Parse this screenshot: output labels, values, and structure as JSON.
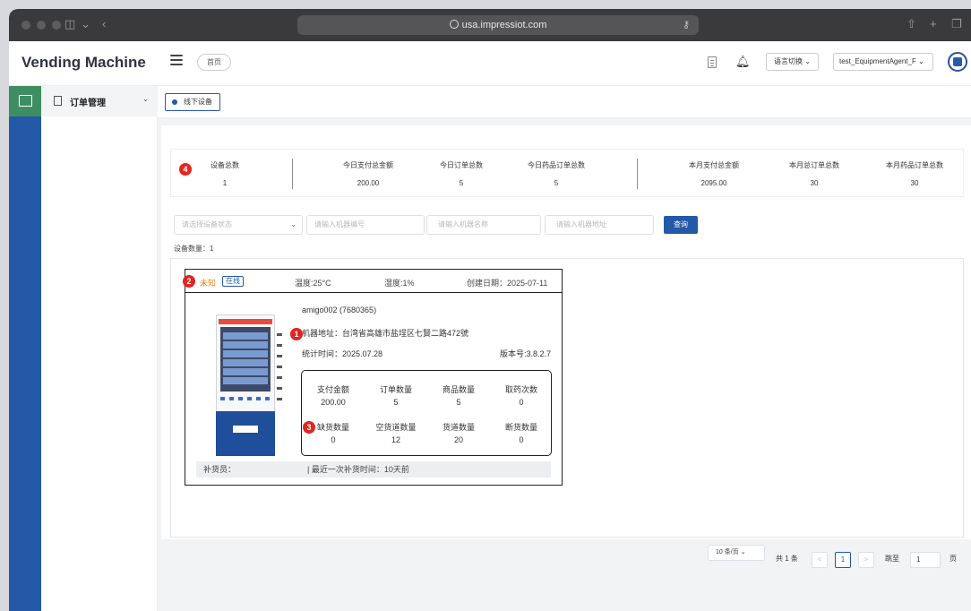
{
  "browser": {
    "url": "usa.impressiot.com"
  },
  "header": {
    "brand": "Vending Machine",
    "home_tab": "首页",
    "lang_label": "语言切换 ⌄",
    "agent_label": "test_EquipmentAgent_F ⌄"
  },
  "sidebar": {
    "menu_label": "订单管理",
    "chevron": "⌄"
  },
  "tagbar": {
    "active_tag": "线下设备"
  },
  "stats": [
    {
      "title": "设备总数",
      "value": "1"
    },
    {
      "title": "今日支付总金额",
      "value": "200.00"
    },
    {
      "title": "今日订单总数",
      "value": "5"
    },
    {
      "title": "今日药品订单总数",
      "value": "5"
    },
    {
      "title": "本月支付总金额",
      "value": "2095.00"
    },
    {
      "title": "本月总订单总数",
      "value": "30"
    },
    {
      "title": "本月药品订单总数",
      "value": "30"
    }
  ],
  "filters": {
    "status_placeholder": "请选择设备状态",
    "number_placeholder": "请输入机器编号",
    "name_placeholder": "请输入机器名称",
    "address_placeholder": "请输入机器地址",
    "query_label": "查询"
  },
  "device_count_label": "设备数量：1",
  "machine": {
    "status": "未知",
    "online": "在线",
    "temperature": "温度:25°C",
    "humidity": "湿度:1%",
    "created": "创建日期：2025-07-11",
    "name": "amigo002 (7680365)",
    "address": "机器地址：台湾省高雄市盐埕区七賢二路472號",
    "stat_time": "统计时间：2025.07.28",
    "version": "版本号:3.8.2.7",
    "metrics": [
      {
        "label": "支付金额",
        "value": "200.00"
      },
      {
        "label": "订单数量",
        "value": "5"
      },
      {
        "label": "商品数量",
        "value": "5"
      },
      {
        "label": "取药次数",
        "value": "0"
      },
      {
        "label": "缺货数量",
        "value": "0"
      },
      {
        "label": "空货道数量",
        "value": "12"
      },
      {
        "label": "货道数量",
        "value": "20"
      },
      {
        "label": "断货数量",
        "value": "0"
      }
    ],
    "restocker": "补货员：",
    "last_restock": "| 最近一次补货时间：10天前"
  },
  "badges": [
    "1",
    "2",
    "3",
    "4"
  ],
  "pagination": {
    "page_size": "10 条/页 ⌄",
    "total": "共 1 条",
    "prev": "<",
    "current": "1",
    "next": ">",
    "jump_label": "跳至",
    "jump_value": "1",
    "page_unit": "页"
  }
}
